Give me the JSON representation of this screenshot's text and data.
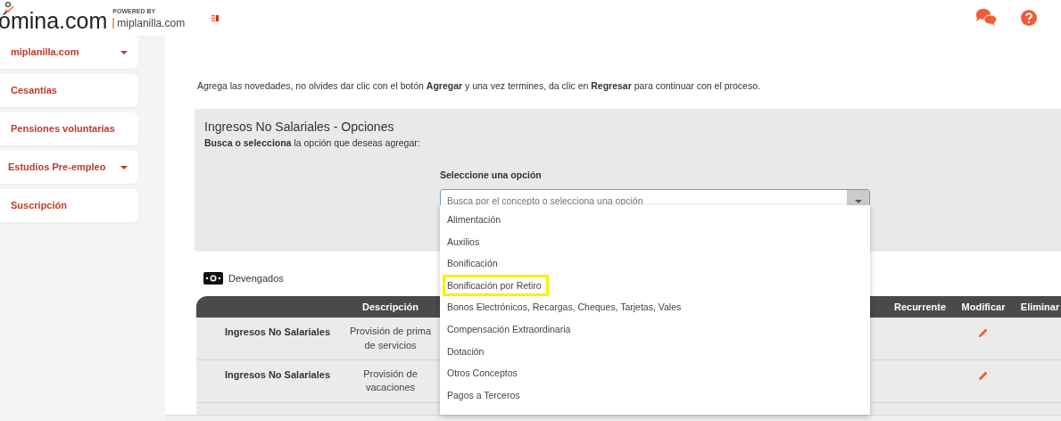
{
  "logo": {
    "name": "ómina.com",
    "powered_by": "POWERED BY",
    "partner": "miplanilla.com"
  },
  "sidebar": {
    "items": [
      {
        "label": "miplanilla.com",
        "has_submenu": true
      },
      {
        "label": "Cesantías",
        "has_submenu": false
      },
      {
        "label": "Pensiones voluntarias",
        "has_submenu": false
      },
      {
        "label": "Estudios Pre-empleo",
        "has_submenu": true
      },
      {
        "label": "Suscripción",
        "has_submenu": false
      }
    ]
  },
  "instructions": "Agrega las novedades, no olvides dar clic con el botón **Agregar** y una vez termines, da clic en **Regresar** para continuar con el proceso.",
  "panel": {
    "title": "Ingresos No Salariales - Opciones",
    "subtitle": "**Busca o selecciona** la opción que deseas agregar:",
    "select_label": "Seleccione una opción",
    "placeholder": "Busca por el concepto o selecciona una opción",
    "options": [
      {
        "label": "Alimentación",
        "highlighted": false
      },
      {
        "label": "Auxilios",
        "highlighted": false
      },
      {
        "label": "Bonificación",
        "highlighted": false
      },
      {
        "label": "Bonificación por Retiro",
        "highlighted": true
      },
      {
        "label": "Bonos Electrónicos, Recargas, Cheques, Tarjetas, Vales",
        "highlighted": false
      },
      {
        "label": "Compensación Extraordinaria",
        "highlighted": false
      },
      {
        "label": "Dotación",
        "highlighted": false
      },
      {
        "label": "Otros Conceptos",
        "highlighted": false
      },
      {
        "label": "Pagos a Terceros",
        "highlighted": false
      }
    ]
  },
  "section": {
    "title": "Devengados"
  },
  "table": {
    "columns": [
      "Descripción",
      "Recurrente",
      "Modificar",
      "Eliminar"
    ],
    "rows": [
      {
        "concept": "Ingresos No Salariales",
        "description": "Provisión de prima de servicios",
        "editable": true
      },
      {
        "concept": "Ingresos No Salariales",
        "description": "Provisión de vacaciones",
        "editable": true
      }
    ]
  }
}
